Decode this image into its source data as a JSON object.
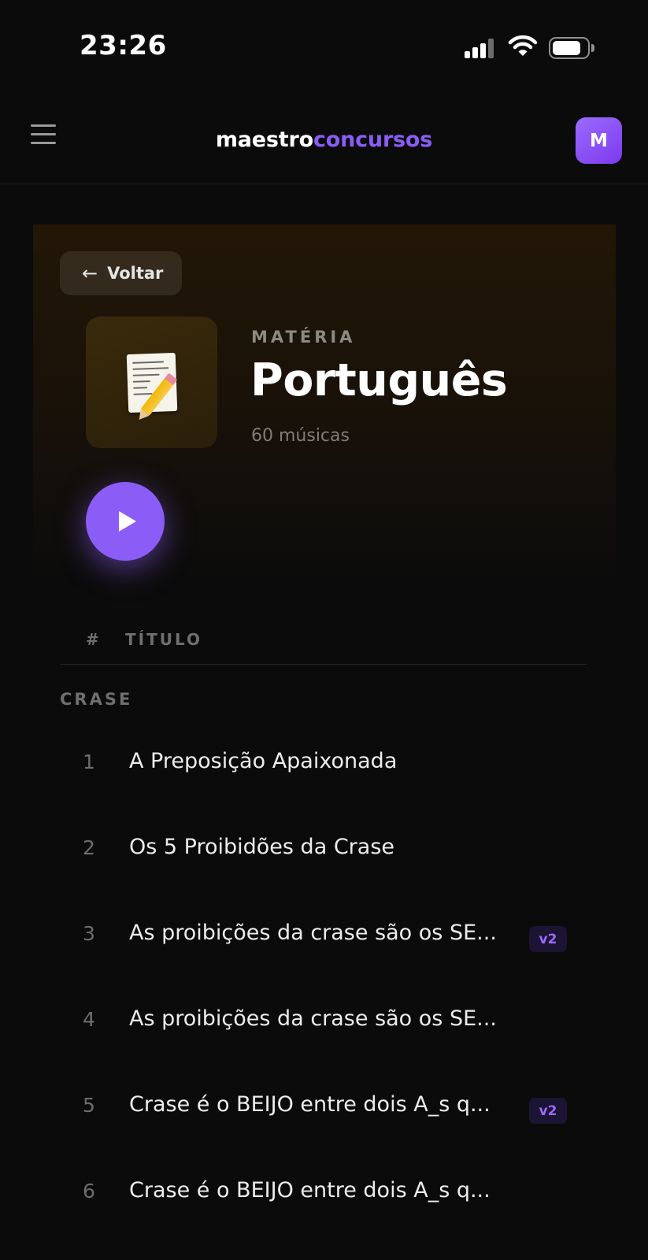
{
  "status_bar": {
    "time": "23:26"
  },
  "header": {
    "logo_part1": "maestro",
    "logo_part2": "concursos",
    "avatar_initial": "M",
    "brand_color": "#8b5cf6"
  },
  "hero": {
    "back_label": "Voltar",
    "kicker": "MATÉRIA",
    "title": "Português",
    "song_count": "60 músicas",
    "cover_icon": "memo-icon"
  },
  "table": {
    "col_num": "#",
    "col_title": "TÍTULO"
  },
  "section": {
    "label": "CRASE"
  },
  "tracks": [
    {
      "num": "1",
      "title": "A Preposição Apaixonada",
      "badge": ""
    },
    {
      "num": "2",
      "title": "Os 5 Proibidões da Crase",
      "badge": ""
    },
    {
      "num": "3",
      "title": "As proibições da crase são os SE...",
      "badge": "v2"
    },
    {
      "num": "4",
      "title": "As proibições da crase são os SE...",
      "badge": ""
    },
    {
      "num": "5",
      "title": "Crase é o BEIJO entre dois A_s q...",
      "badge": "v2"
    },
    {
      "num": "6",
      "title": "Crase é o BEIJO entre dois A_s q...",
      "badge": ""
    }
  ]
}
